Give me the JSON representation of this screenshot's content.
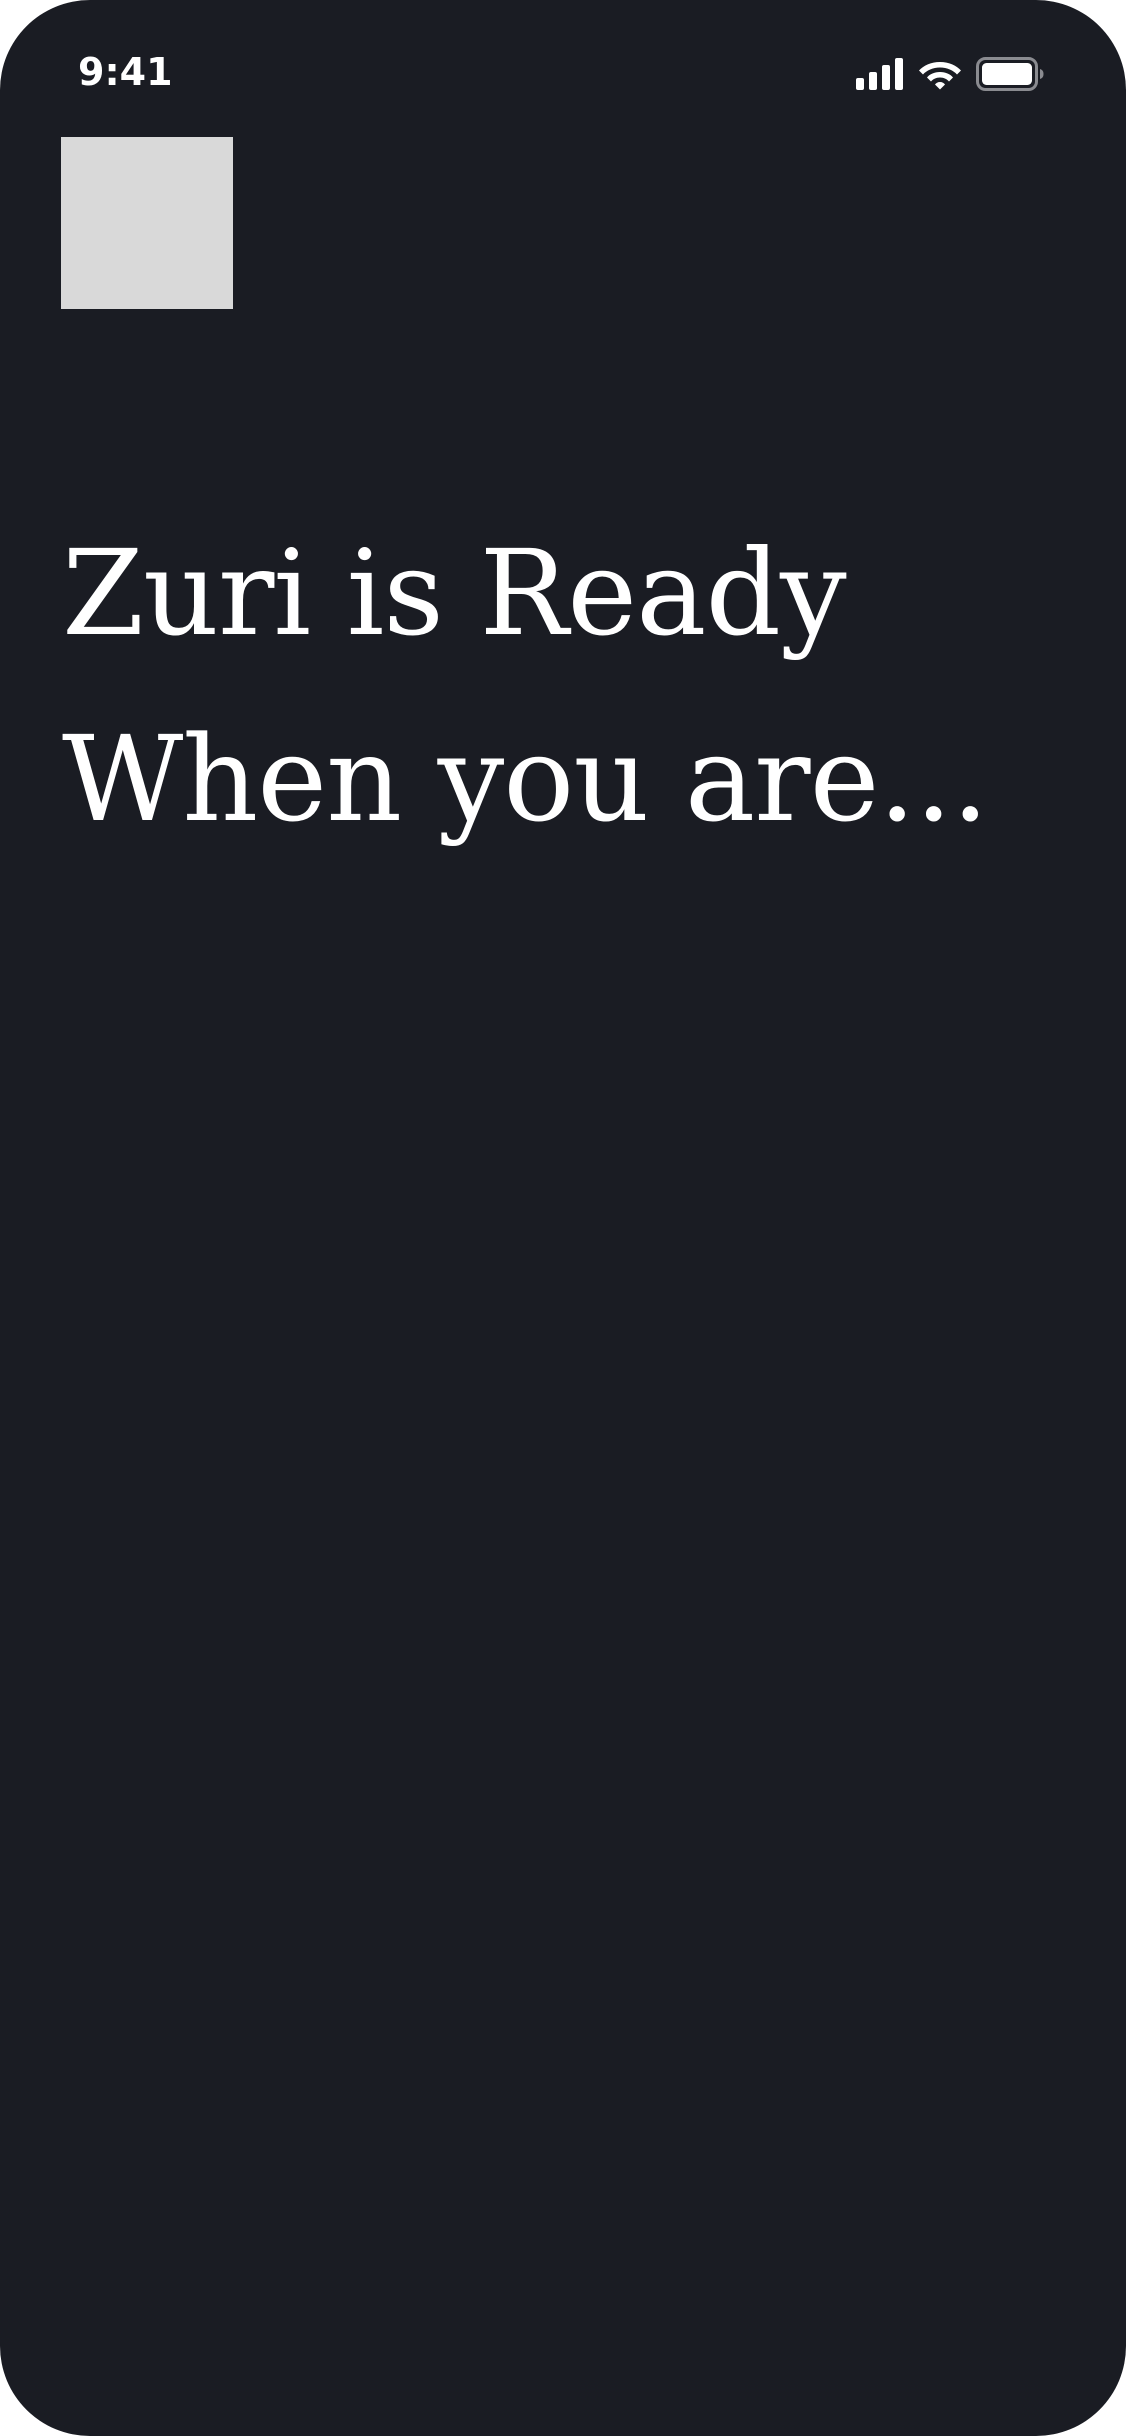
{
  "status_bar": {
    "time": "9:41",
    "icons": [
      "cellular-signal-icon",
      "wifi-icon",
      "battery-icon"
    ]
  },
  "main": {
    "image_placeholder": "placeholder-image",
    "headline_line1": "Zuri is Ready",
    "headline_line2": "When you are..."
  },
  "colors": {
    "background": "#1a1c23",
    "text": "#ffffff",
    "placeholder": "#d9d9d9"
  }
}
